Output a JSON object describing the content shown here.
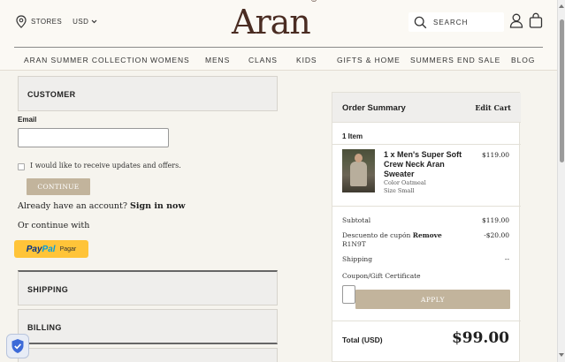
{
  "header": {
    "stores_label": "STORES",
    "currency": "USD",
    "logo_text": "Aran",
    "logo_mark": "®",
    "search_label": "SEARCH"
  },
  "nav": {
    "items": [
      "ARAN SUMMER COLLECTION",
      "WOMENS",
      "MENS",
      "CLANS",
      "KIDS",
      "GIFTS & HOME",
      "SUMMERS END SALE",
      "BLOG"
    ]
  },
  "checkout": {
    "customer_heading": "CUSTOMER",
    "email_label": "Email",
    "email_value": "",
    "updates_checkbox_label": "I would like to receive updates and offers.",
    "updates_checked": false,
    "continue_label": "CONTINUE",
    "have_account_text": "Already have an account?",
    "sign_in_link": "Sign in now",
    "or_continue_text": "Or continue with",
    "paypal_part1": "Pay",
    "paypal_part2": "Pal",
    "paypal_pagar": "Pagar",
    "shipping_heading": "SHIPPING",
    "billing_heading": "BILLING"
  },
  "summary": {
    "title": "Order Summary",
    "edit_cart": "Edit Cart",
    "item_count": "1 Item",
    "item": {
      "name": "1 x Men's Super Soft Crew Neck Aran Sweater",
      "price": "$119.00",
      "color": "Color Oatmeal",
      "size": "Size Small"
    },
    "subtotal_label": "Subtotal",
    "subtotal_value": "$119.00",
    "discount_label": "Descuento de cupón",
    "discount_remove": "Remove",
    "discount_code": "R1N9T",
    "discount_value": "-$20.00",
    "shipping_label": "Shipping",
    "shipping_value": "--",
    "coupon_label": "Coupon/Gift Certificate",
    "coupon_value": "",
    "apply_label": "APPLY",
    "total_label": "Total (USD)",
    "total_value": "$99.00"
  },
  "colors": {
    "brand": "#4a2c22",
    "button_tan": "#c2b49c",
    "paypal_yellow": "#ffc439",
    "background": "#f6f4ee"
  }
}
